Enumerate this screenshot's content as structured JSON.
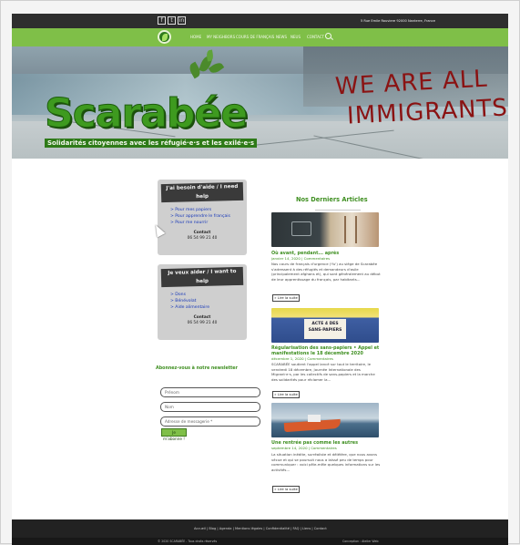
{
  "topbar": {
    "social": [
      "f",
      "t",
      "in"
    ],
    "address": "5 Rue Emile Rouviere 92000 Nanterre, France"
  },
  "nav": {
    "items": [
      "HOME",
      "MY NEIGHBORS",
      "COURS DE FRANÇAIS",
      "NEWS",
      "NEUS",
      "CONTACT"
    ]
  },
  "hero": {
    "brand": "Scarabée",
    "tagline": "Solidarités citoyennes avec les réfugié·e·s et les exilé·e·s",
    "graffiti_line1": "WE ARE ALL",
    "graffiti_line2": "IMMIGRANTS"
  },
  "help1": {
    "title": "J'ai besoin d'aide / I need help",
    "links": [
      "> Pour mes papiers",
      "> Pour apprendre le français",
      "> Pour me nourrir"
    ],
    "contact_label": "Contact",
    "contact_phone": "06 54 99 21 40"
  },
  "help2": {
    "title": "Je veux aider / I want to help",
    "links": [
      "> Dons",
      "> Bénévolat",
      "> Aide alimentaire"
    ],
    "contact_label": "Contact",
    "contact_phone": "06 54 99 21 40"
  },
  "newsletter": {
    "title": "Abonnez-vous à notre newsletter",
    "prenom_placeholder": "Prénom",
    "nom_placeholder": "Nom",
    "email_placeholder": "Adresse de messagerie *",
    "submit_label": "Je m'abonne !"
  },
  "articles": {
    "heading": "Nos Derniers Articles",
    "items": [
      {
        "title": "Où avant, pendant... après",
        "meta": "janvier 14, 2020 | Commentaires",
        "excerpt": "Nos cours de français d'urgence ('fu') au siège de Scarabée s'adressent à des réfugiés et demandeurs d'asile (principalement afghans et), qui sont généralement au début de leur apprentissage du français, par habitants...",
        "more": "» Lire la suite"
      },
      {
        "title": "Régularisation des sans-papiers • Appel et manifestations le 18 décembre 2020",
        "meta": "décembre 1, 2020 | Commentaires",
        "excerpt": "SCARABÉE soutient l'appel lancé sur tout le territoire, le vendredi 18 décembre, Journée Internationale des Migrant·e·s, par les collectifs de sans-papiers et la marche des solidarités pour réclamer la...",
        "more": "» Lire la suite"
      },
      {
        "title": "Une rentrée pas comme les autres",
        "meta": "septembre 14, 2020 | Commentaires",
        "excerpt": "La situation inédite, surréaliste et délétère, que nous avons vécue et qui se poursuit nous a laissé peu de temps pour communiquer : voici pêle-mêle quelques informations sur les activités...",
        "more": "» Lire la suite"
      }
    ],
    "flyer_text": "ACTE 4 DES SANS-PAPIERS"
  },
  "footer": {
    "links": "Accueil | Blog | Agenda | Mentions légales | Confidentialité | FAQ | Liens | Contact",
    "copyright": "© 2020 SCARABÉE - Tous droits réservés",
    "design": "Conception : Atelier Web"
  }
}
